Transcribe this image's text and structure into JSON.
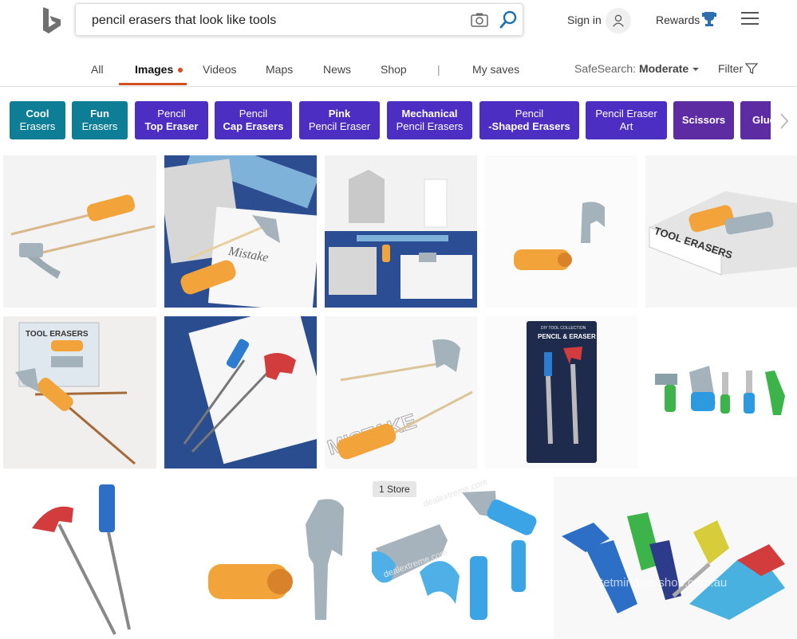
{
  "search": {
    "query": "pencil erasers that look like tools"
  },
  "header": {
    "signin_label": "Sign in",
    "rewards_label": "Rewards"
  },
  "tabs": [
    {
      "label": "All"
    },
    {
      "label": "Images"
    },
    {
      "label": "Videos"
    },
    {
      "label": "Maps"
    },
    {
      "label": "News"
    },
    {
      "label": "Shop"
    },
    {
      "label": "My saves"
    }
  ],
  "tab_divider": "|",
  "safesearch": {
    "label": "SafeSearch:",
    "value": "Moderate"
  },
  "filter_label": "Filter",
  "chips": [
    {
      "line1": "Cool",
      "line2": "Erasers",
      "color": "#0e7e96"
    },
    {
      "line1": "Fun",
      "line2": "Erasers",
      "color": "#0e7e96"
    },
    {
      "line1": "Pencil",
      "line2": "Top Eraser",
      "color": "#4c2fc2"
    },
    {
      "line1": "Pencil",
      "line2": "Cap Erasers",
      "color": "#4c2fc2"
    },
    {
      "line1": "Pink",
      "line2": "Pencil Eraser",
      "color": "#4c2fc2"
    },
    {
      "line1": "Mechanical",
      "line2": "Pencil Erasers",
      "color": "#4c2fc2"
    },
    {
      "line1": "Pencil",
      "line2": "-Shaped Erasers",
      "color": "#4c2fc2"
    },
    {
      "line1": "Pencil Eraser",
      "line2": "Art",
      "color": "#4c2fc2"
    },
    {
      "line1": "Scissors",
      "line2": "",
      "color": "#5e2ca2"
    },
    {
      "line1": "Glue",
      "line2": "",
      "color": "#5e2ca2"
    }
  ],
  "results": {
    "store_badge": "1 Store",
    "watermarks": [
      "dealextreme.com",
      "tetmindset.shop.com.au"
    ],
    "thumb_texts": [
      "TOOL ERASERS",
      "Mistake",
      "DIY TOOL COLLECTION",
      "PENCIL & ERASER",
      "MISTAKE"
    ]
  },
  "colors": {
    "accent": "#d34f1f",
    "teal_chip": "#0e7e96",
    "purple_chip": "#4c2fc2"
  }
}
